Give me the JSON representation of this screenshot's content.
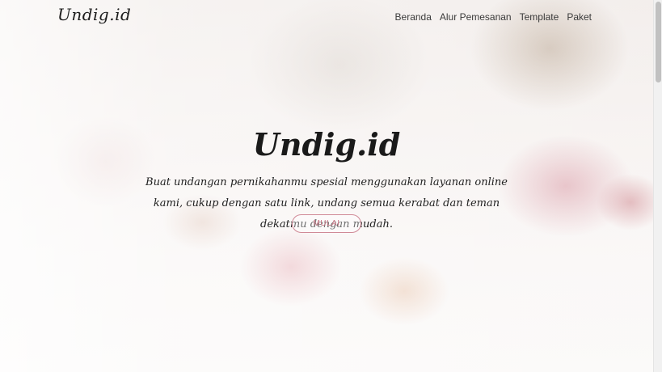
{
  "navbar": {
    "brand": "Undig.id",
    "links": [
      "Beranda",
      "Alur Pemesanan",
      "Template",
      "Paket"
    ]
  },
  "hero": {
    "title": "Undig.id",
    "subtitle": "Buat undangan pernikahanmu spesial menggunakan layanan online kami, cukup dengan satu link, undang semua kerabat dan teman dekatmu dengan mudah.",
    "cta_label": "MULAI"
  },
  "colors": {
    "accent": "#d08a97",
    "text": "#1a1a1a"
  }
}
